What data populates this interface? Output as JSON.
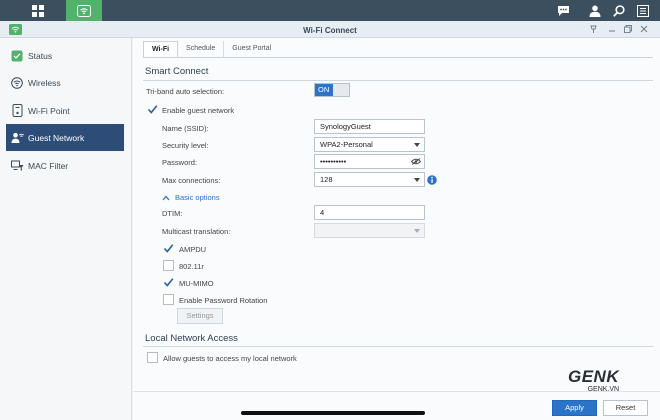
{
  "taskbar": {
    "icons": [
      "grid-icon",
      "wifi-icon",
      "chat-icon",
      "user-icon",
      "search-icon",
      "options-icon"
    ]
  },
  "window": {
    "title": "Wi-Fi Connect",
    "controls": [
      "pin",
      "minimize",
      "maximize",
      "close"
    ]
  },
  "sidebar": {
    "items": [
      {
        "label": "Status",
        "icon": "status-icon"
      },
      {
        "label": "Wireless",
        "icon": "wireless-icon"
      },
      {
        "label": "Wi-Fi Point",
        "icon": "wifi-point-icon"
      },
      {
        "label": "Guest Network",
        "icon": "guest-network-icon",
        "active": true
      },
      {
        "label": "MAC Filter",
        "icon": "mac-filter-icon"
      }
    ]
  },
  "tabs": [
    {
      "label": "Wi-Fi",
      "active": true
    },
    {
      "label": "Schedule"
    },
    {
      "label": "Guest Portal"
    }
  ],
  "smart_connect": {
    "title": "Smart Connect",
    "triband_label": "Tri-band auto selection:",
    "triband_value": "ON",
    "enable_guest_label": "Enable guest network",
    "enable_guest_checked": true,
    "ssid_label": "Name (SSID):",
    "ssid_value": "SynologyGuest",
    "security_label": "Security level:",
    "security_value": "WPA2-Personal",
    "password_label": "Password:",
    "password_value": "••••••••••",
    "maxconn_label": "Max connections:",
    "maxconn_value": "128",
    "basic_options_label": "Basic options",
    "dtim_label": "DTIM:",
    "dtim_value": "4",
    "multicast_label": "Multicast translation:",
    "multicast_value": "",
    "options": [
      {
        "label": "AMPDU",
        "checked": true
      },
      {
        "label": "802.11r",
        "checked": false
      },
      {
        "label": "MU-MIMO",
        "checked": true
      },
      {
        "label": "Enable Password Rotation",
        "checked": false
      }
    ],
    "settings_label": "Settings"
  },
  "local_access": {
    "title": "Local Network Access",
    "allow_label": "Allow guests to access my local network",
    "allow_checked": false
  },
  "footer": {
    "apply_label": "Apply",
    "reset_label": "Reset"
  },
  "watermark": {
    "brand": "GENK",
    "site": "GENK.VN"
  },
  "colors": {
    "accent": "#2b74c8",
    "sidebar_active": "#2d4d78",
    "taskbar": "#3b4f5e",
    "wifi_green": "#52b26b"
  }
}
